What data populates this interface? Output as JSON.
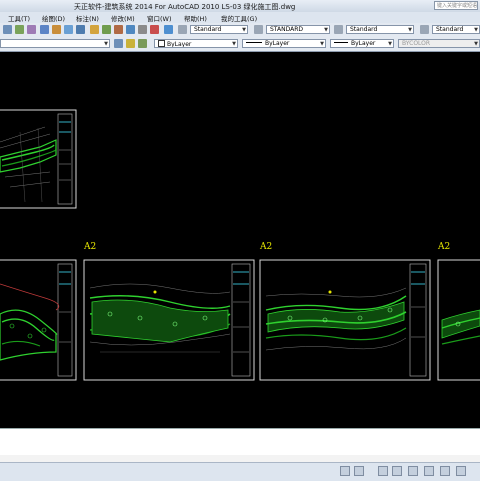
{
  "window": {
    "title": "天正软件-建筑系统 2014  For AutoCAD 2010      LS-03 绿化施工图.dwg",
    "search_placeholder": "键入关键字或短语"
  },
  "menu": [
    "工具(T)",
    "绘图(D)",
    "标注(N)",
    "修改(M)",
    "窗口(W)",
    "帮助(H)",
    "我的工具(G)"
  ],
  "toolbar1": {
    "text_style": "Standard",
    "dim_style": "STANDARD",
    "table_style": "Standard",
    "multileader_style": "Standard"
  },
  "toolbar2": {
    "color": "ByLayer",
    "linetype": "ByLayer",
    "lineweight": "ByLayer",
    "plotstyle": "BYCOLOR"
  },
  "sheets": [
    {
      "label": "A2"
    },
    {
      "label": "A2"
    },
    {
      "label": "A2"
    }
  ],
  "colors": {
    "canvas": "#000000",
    "plan_green": "#2fd12f",
    "sheet_label": "#e6e600",
    "frame": "#e0e0e0"
  }
}
